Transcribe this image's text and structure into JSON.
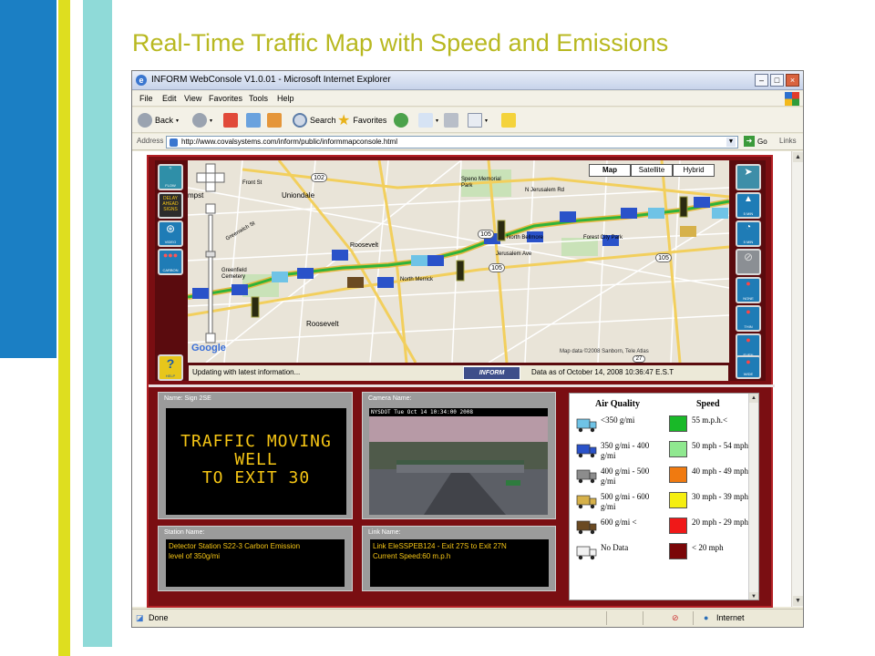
{
  "slide": {
    "title": "Real-Time Traffic Map with Speed and Emissions"
  },
  "browser": {
    "title": "INFORM WebConsole V1.0.01 - Microsoft Internet Explorer",
    "menu": [
      "File",
      "Edit",
      "View",
      "Favorites",
      "Tools",
      "Help"
    ],
    "toolbar": {
      "back": "Back",
      "search": "Search",
      "favorites": "Favorites"
    },
    "address_label": "Address",
    "url": "http://www.covalsystems.com/inform/public/informmapconsole.html",
    "go": "Go",
    "links": "Links",
    "status": {
      "left": "Done",
      "zone": "Internet"
    }
  },
  "map": {
    "type_buttons": [
      "Map",
      "Satellite",
      "Hybrid"
    ],
    "selected_type": "Map",
    "left_buttons": [
      "FLOW",
      "DELAY AHEAD SIGNS",
      "VIDEO",
      "CARBON"
    ],
    "help_button": "HELP",
    "right_buttons": [
      "",
      "5 MIN",
      "5 MIN",
      "",
      "NONE",
      "THIN",
      "EVEN",
      "WIDE"
    ],
    "place_labels": [
      "Uniondale",
      "Roosevelt",
      "Roosevelt",
      "Greenfield Cemetery",
      "North Merrick",
      "North Bellmore",
      "Forest City Park",
      "Jerusalem Ave",
      "Front St",
      "Greenwich St",
      "Speno Memorial Park",
      "N Jerusalem Rd",
      "mpst"
    ],
    "route_shields": [
      "102",
      "105",
      "105",
      "105",
      "27"
    ],
    "data_credit": "Map data ©2008 Sanborn, Tele Atlas",
    "status_left": "Updating with latest information...",
    "logo": "INFORM",
    "status_right": "Data as of October 14, 2008 10:36:47 E.S.T"
  },
  "sign_panel": {
    "label": "Name: Sign 2SE",
    "lines": [
      "TRAFFIC MOVING",
      "WELL",
      "TO EXIT 30"
    ]
  },
  "camera_panel": {
    "label": "Camera Name:",
    "overlay": "NYSDOT Tue Oct 14 10:34:00 2008"
  },
  "station_panel": {
    "label": "Station Name:",
    "lines": [
      "Detector Station S22-3 Carbon Emission",
      "level of 350g/mi"
    ]
  },
  "link_panel": {
    "label": "Link Name:",
    "lines": [
      "Link EleSSPEB124 - Exit 27S to Exit 27N",
      "Current Speed:60 m.p.h"
    ]
  },
  "legend": {
    "air_header": "Air Quality",
    "speed_header": "Speed",
    "rows": [
      {
        "air": "<350 g/mi",
        "speed": "55 m.p.h.<",
        "truck": "#6fc3e6",
        "swatch": "#19b928"
      },
      {
        "air": "350 g/mi - 400 g/mi",
        "speed": "50 mph - 54 mph",
        "truck": "#2a52c9",
        "swatch": "#8fe88f"
      },
      {
        "air": "400 g/mi - 500 g/mi",
        "speed": "40 mph - 49 mph",
        "truck": "#8c8c8c",
        "swatch": "#f07a10"
      },
      {
        "air": "500 g/mi - 600 g/mi",
        "speed": "30 mph - 39 mph",
        "truck": "#d6b14a",
        "swatch": "#f5ee10"
      },
      {
        "air": "600 g/mi <",
        "speed": "20 mph - 29 mph",
        "truck": "#6b4a22",
        "swatch": "#f01818"
      },
      {
        "air": "No Data",
        "speed": "< 20 mph",
        "truck": "#f2f2f2",
        "swatch": "#7a0608"
      }
    ]
  },
  "colors": {
    "slide_title": "#b8b820",
    "app_frame": "#7a0e12",
    "led_text": "#f5c515",
    "route_line": "#2fb33a"
  }
}
